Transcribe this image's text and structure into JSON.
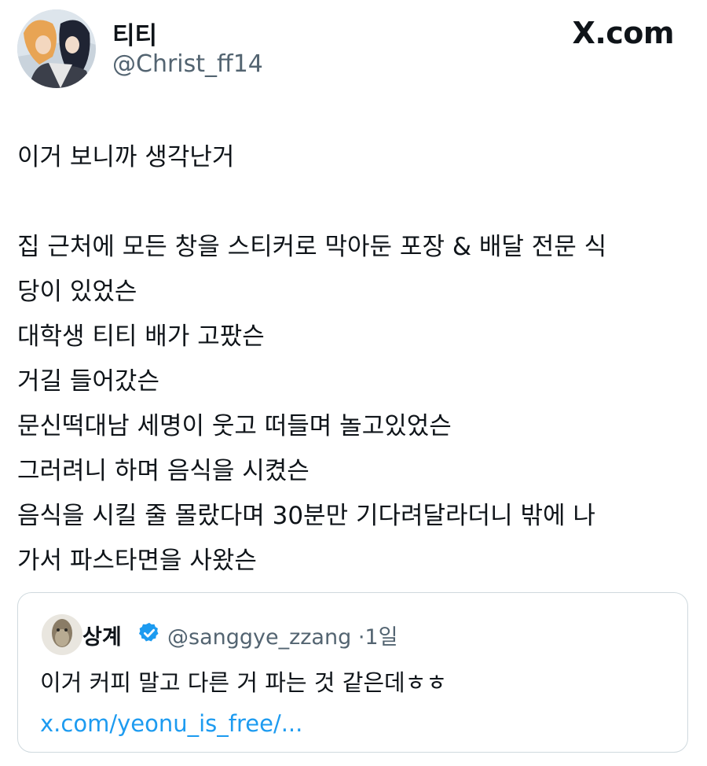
{
  "author": {
    "display_name": "티티",
    "handle": "@Christ_ff14"
  },
  "brand": "X.com",
  "tweet": {
    "text": "이거 보니까 생각난거\n\n집 근처에 모든 창을 스티커로 막아둔 포장 & 배달 전문 식\n당이 있었슨\n대학생 티티 배가 고팠슨\n거길 들어갔슨\n문신떡대남 세명이 웃고 떠들며 놀고있었슨\n그러려니 하며 음식을 시켰슨\n음식을 시킬 줄 몰랐다며 30분만 기다려달라더니 밖에 나\n가서 파스타면을 사왔슨"
  },
  "quote": {
    "display_name": "상계",
    "handle": "@sanggye_zzang",
    "separator": "·",
    "time": "1일",
    "text": "이거 커피 말고 다른 거 파는 것 같은데ㅎㅎ ",
    "link": "x.com/yeonu_is_free/..."
  },
  "icons": {
    "avatar": "avatar-illustration",
    "quote_avatar": "avatar-illustration",
    "verified": "verified-badge-icon"
  },
  "colors": {
    "link": "#1d9bf0",
    "secondary_text": "#536471",
    "verified": "#1d9bf0"
  }
}
